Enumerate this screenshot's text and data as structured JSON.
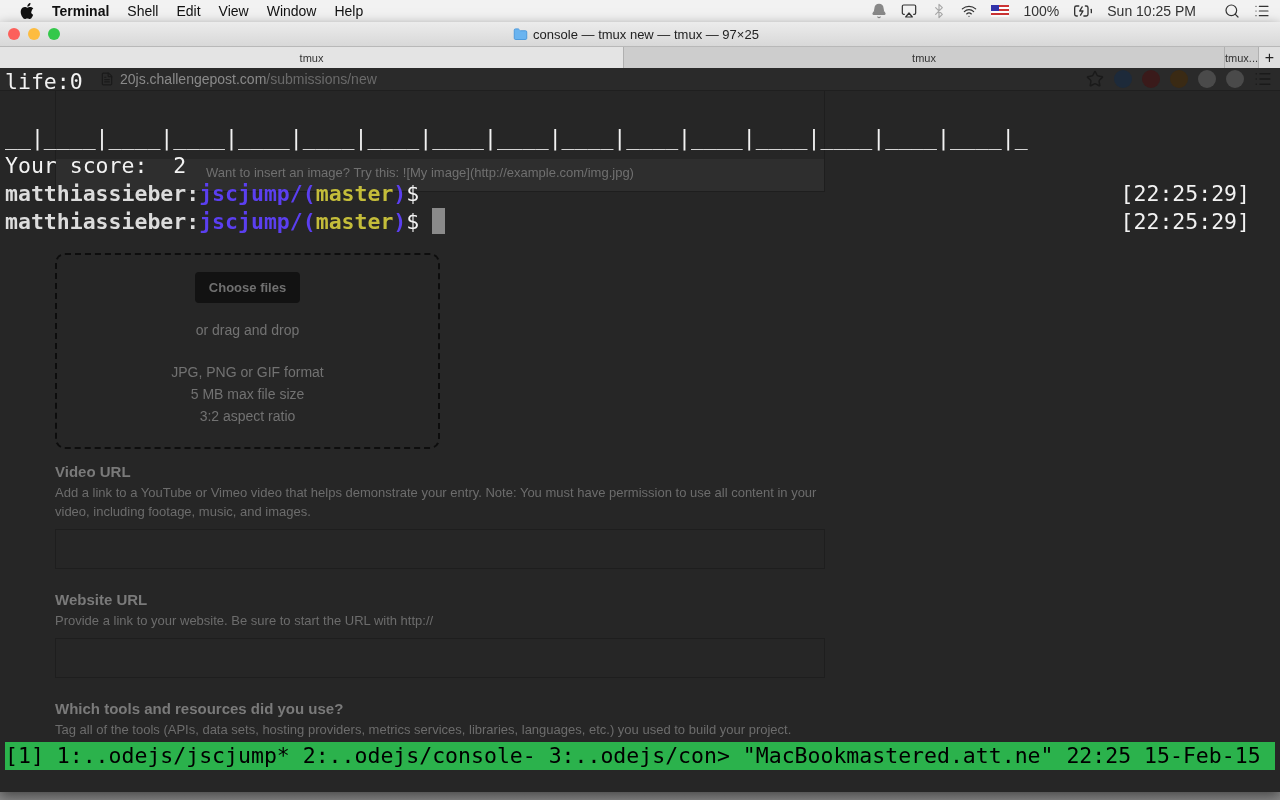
{
  "menubar": {
    "app": "Terminal",
    "menus": [
      "Shell",
      "Edit",
      "View",
      "Window",
      "Help"
    ],
    "battery": "100%",
    "clock": "Sun 10:25 PM"
  },
  "window": {
    "title": "console — tmux new — tmux — 97×25",
    "tabs": [
      {
        "label": "tmux",
        "selected": true
      },
      {
        "label": "tmux",
        "selected": false
      },
      {
        "label": "tmux...",
        "selected": false
      }
    ],
    "new_tab": "+"
  },
  "browser": {
    "url_host": "20js.challengepost.com",
    "url_path": "/submissions/new",
    "hint": "Want to insert an image? Try this: ![My image](http://example.com/img.jpg)",
    "dropzone": {
      "button": "Choose files",
      "or": "or drag and drop",
      "notes": [
        "JPG, PNG or GIF format",
        "5 MB max file size",
        "3:2 aspect ratio"
      ]
    },
    "fields": [
      {
        "label": "Video URL",
        "help": "Add a link to a YouTube or Vimeo video that helps demonstrate your entry. Note: You must have permission to use all content in your video, including footage, music, and images."
      },
      {
        "label": "Website URL",
        "help": "Provide a link to your website. Be sure to start the URL with http://"
      },
      {
        "label": "Which tools and resources did you use?",
        "help": "Tag all of the tools (APIs, data sets, hosting providers, metrics services, libraries, languages, etc.) you used to build your project."
      }
    ]
  },
  "terminal": {
    "lines": [
      {
        "kind": "plain",
        "text": "life:0"
      },
      {
        "kind": "blank"
      },
      {
        "kind": "plain",
        "text": "__|____|____|____|____|____|____|____|____|____|____|____|____|____|____|____|_"
      },
      {
        "kind": "plain",
        "text": "Your score:  2"
      },
      {
        "kind": "prompt",
        "user": "matthiassieber:",
        "dir": "jscjump/",
        "open": "(",
        "branch": "master",
        "close": ")",
        "symbol": "$",
        "time": "[22:25:29]",
        "cursor": false
      },
      {
        "kind": "prompt",
        "user": "matthiassieber:",
        "dir": "jscjump/",
        "open": "(",
        "branch": "master",
        "close": ")",
        "symbol": "$",
        "time": "[22:25:29]",
        "cursor": true
      }
    ],
    "status_bar": "[1] 1:..odejs/jscjump* 2:..odejs/console- 3:..odejs/con> \"MacBookmastered.att.ne\" 22:25 15-Feb-15"
  }
}
